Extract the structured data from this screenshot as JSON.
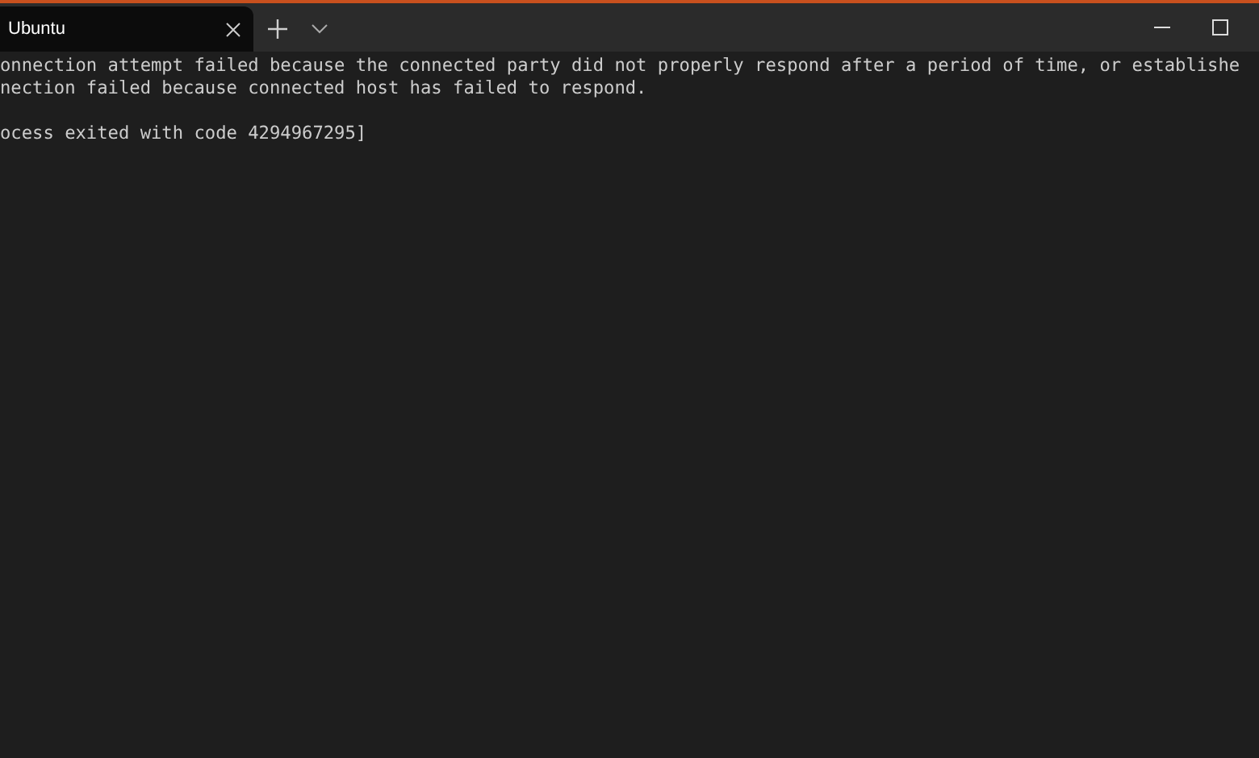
{
  "tabs": [
    {
      "label": "Ubuntu",
      "selected": true
    }
  ],
  "terminal": {
    "error_lines": [
      "onnection attempt failed because the connected party did not properly respond after a period of time, or establishe",
      "nection failed because connected host has failed to respond."
    ],
    "exit_message": "ocess exited with code 4294967295]"
  }
}
